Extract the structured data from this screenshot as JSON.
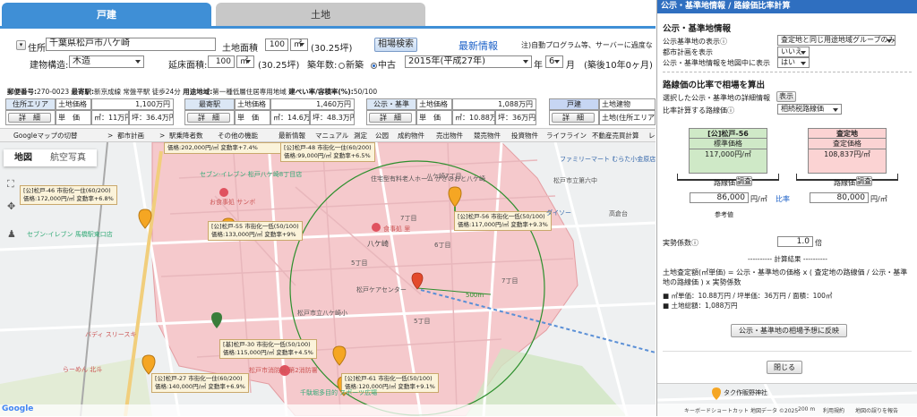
{
  "tabs": {
    "house": "戸建",
    "land": "土地"
  },
  "form": {
    "address_label": "住所",
    "address_value": "千葉県松戸市八ケ崎",
    "land_area_label": "土地面積",
    "land_area_value": "100",
    "land_area_unit": "㎡",
    "land_area_tsubo": "(30.25坪)",
    "search_button": "相場検索",
    "latest_info": "最新情報",
    "note": "注)自動プログラム等、サーバーに過度な",
    "structure_label": "建物構造:",
    "structure_value": "木造",
    "floor_area_label": "延床面積:",
    "floor_area_value": "100",
    "floor_area_unit": "㎡",
    "floor_area_tsubo": "(30.25坪)",
    "age_label": "築年数:",
    "new_label": "新築",
    "used_label": "中古",
    "year_value": "2015年(平成27年)",
    "year_suffix": "年",
    "month_value": "6",
    "month_suffix": "月",
    "age_text": "(築後10年0ヶ月)"
  },
  "info_line": {
    "postal_label": "郵便番号:",
    "postal": "270-0023",
    "station_label": "最寄駅:",
    "station": "新京成線 常盤平駅 徒歩24分",
    "zone_label": "用途地域:",
    "zone": "第一種低層住居専用地域",
    "ratio_label": "建ぺい率/容積率(%):",
    "ratio": "50/100"
  },
  "price_table": {
    "area_header": "住所エリア",
    "nearest_header": "最寄駅",
    "public_header": "公示・基準",
    "house_header": "戸建",
    "land_price_label": "土地価格",
    "unit_label": "単　価",
    "detail": "詳　細",
    "area_price": "1,100万円",
    "area_sqm": "㎡：11万円",
    "area_tsubo": "坪：36.4万円",
    "nearest_price": "1,460万円",
    "nearest_sqm": "㎡：14.6万円",
    "nearest_tsubo": "坪：48.3万円",
    "public_price": "1,088万円",
    "public_sqm": "㎡：10.88万円",
    "public_tsubo": "坪：36万円",
    "house_land_label": "土地建物",
    "house_land_sub": "土地(住所エリア"
  },
  "toolbar": [
    "Googleマップの切替",
    "都市計画",
    "駅乗降者数",
    "その他の機能",
    "最新情報",
    "マニュアル",
    "測定",
    "公园",
    "成約物件",
    "売出物件",
    "競売物件",
    "投資物件",
    "ライフライン",
    "不動産売買計算",
    "レ"
  ],
  "map": {
    "view_map": "地図",
    "view_satellite": "航空写真",
    "cards": [
      {
        "title": "[公]松戸-48 市街化一住(60/200)",
        "body": "価格:99,000円/㎡ 変動率+6.5%"
      },
      {
        "title": "[公]松戸-46 市街化一住(60/200)",
        "body": "価格:172,000円/㎡ 変動率+6.8%"
      },
      {
        "title": "[公]松戸-55 市街化一低(50/100)",
        "body": "価格:133,000円/㎡ 変動率+9%"
      },
      {
        "title": "[公]松戸-56 市街化一低(50/100)",
        "body": "価格:117,000円/㎡ 変動率+9.3%"
      },
      {
        "title": "[基]松戸-30 市街化一低(50/100)",
        "body": "価格:115,000円/㎡ 変動率+4.5%"
      },
      {
        "title": "[公]松戸-27 市街化一住(60/200)",
        "body": "価格:140,000円/㎡ 変動率+6.9%"
      },
      {
        "title": "[公]松戸-61 市街化一低(50/100)",
        "body": "価格:120,000円/㎡ 変動率+9.1%"
      },
      {
        "title": "",
        "body": "価格:202,000円/㎡ 変動率+7.4%"
      }
    ],
    "labels": [
      "セブン-イレブン 松戸八ケ崎8丁目店",
      "お食事処 サンボ",
      "住宅型有料老人ホーム かざのおと八ケ崎",
      "食事処 里",
      "八ケ崎",
      "松戸ケアセンター",
      "松戸市立八ケ崎小",
      "セブン-イレブン 馬橋駅東口店",
      "バディ スリースキ",
      "らーめん 北斗",
      "松戸市消防局 第2消防署",
      "千駄堀多目的 スポーツ広場",
      "ファミリーマート むらた小金原店",
      "松戸市立第六中",
      "ダイソー",
      "高倉台",
      "八ケ崎7丁目",
      "7丁目",
      "5丁目",
      "6丁目",
      "7丁目",
      "5丁目",
      "500m",
      "地図データ ©2025",
      "キーボードショートカット",
      "200 m",
      "利用規約",
      "地図の誤りを報告"
    ]
  },
  "panel": {
    "title": "公示・基準地情報 / 路線価比率計算",
    "sec1": "公示・基準地情報",
    "display_label": "公示基準地の表示",
    "display_value": "査定地と同じ用途地域グループのみ",
    "city_label": "都市計画を表示",
    "city_value": "いいえ",
    "show_map_label": "公示・基準地情報を地図中に表示",
    "show_map_value": "はい",
    "sec2": "路線価の比率で相場を算出",
    "detail_label": "選択した公示・基準地の詳細情報",
    "detail_button": "表示",
    "route_label": "比率計算する路線価",
    "route_value": "相続税路線価",
    "left_code": "[公]松戸-56",
    "left_title": "標準価格",
    "left_value": "117,000円/㎡",
    "right_code": "査定地",
    "right_title": "査定価格",
    "right_value": "108,837円/㎡",
    "route_price": "路線価",
    "survey": "調査",
    "left_route_value": "86,000",
    "right_route_value": "80,000",
    "unit": "円/㎡",
    "ratio": "比率",
    "reference": "参考値",
    "factor_label": "実勢係数",
    "factor_value": "1.0",
    "factor_unit": "倍",
    "calc_result": "---------- 計算結果 ----------",
    "formula": "土地査定額(㎡単価) = 公示・基準地の価格 x ( 査定地の路線価 / 公示・基準地の路線価 ) x 実勢係数",
    "result1": "■ ㎡単価：10.88万円 / 坪単価：36万円 / 面積：100㎡",
    "result2": "■ 土地総額：1,088万円",
    "reflect_button": "公示・基準地の相場予想に反映",
    "close_button": "閉じる",
    "mini_map_label": "タク作販野神社"
  }
}
